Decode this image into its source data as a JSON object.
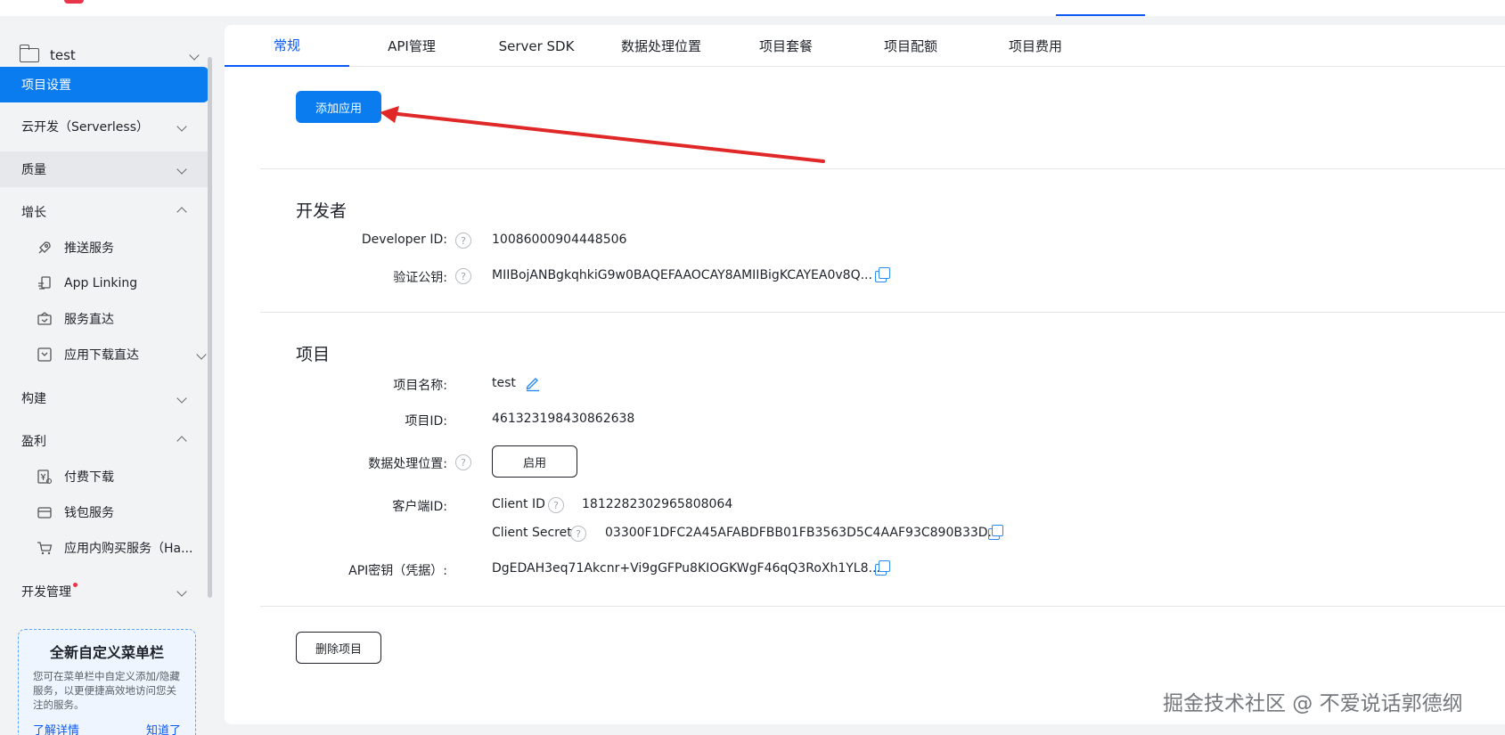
{
  "sidebar": {
    "project_name": "test",
    "nav": [
      {
        "label": "项目设置"
      },
      {
        "label": "云开发（Serverless）"
      },
      {
        "label": "质量"
      },
      {
        "label": "增长"
      },
      {
        "label": "构建"
      },
      {
        "label": "盈利"
      },
      {
        "label": "开发管理"
      }
    ],
    "growth_items": [
      {
        "label": "推送服务",
        "icon": "rocket-icon"
      },
      {
        "label": "App Linking",
        "icon": "link-icon"
      },
      {
        "label": "服务直达",
        "icon": "service-icon"
      },
      {
        "label": "应用下载直达",
        "icon": "download-icon"
      }
    ],
    "monetize_items": [
      {
        "label": "付费下载",
        "icon": "paid-download-icon"
      },
      {
        "label": "钱包服务",
        "icon": "wallet-icon"
      },
      {
        "label": "应用内购买服务（Ha...",
        "icon": "cart-icon"
      }
    ],
    "promo": {
      "title": "全新自定义菜单栏",
      "desc": "您可在菜单栏中自定义添加/隐藏服务，以更便捷高效地访问您关注的服务。",
      "learn_more": "了解详情",
      "got_it": "知道了"
    }
  },
  "tabs": [
    "常规",
    "API管理",
    "Server SDK",
    "数据处理位置",
    "项目套餐",
    "项目配额",
    "项目费用"
  ],
  "add_app_label": "添加应用",
  "developer": {
    "title": "开发者",
    "developer_id_label": "Developer ID:",
    "developer_id": "10086000904448506",
    "public_key_label": "验证公钥:",
    "public_key": "MIIBojANBgkqhkiG9w0BAQEFAAOCAY8AMIIBigKCAYEA0v8Q..."
  },
  "project": {
    "title": "项目",
    "name_label": "项目名称:",
    "name": "test",
    "id_label": "项目ID:",
    "id": "461323198430862638",
    "data_loc_label": "数据处理位置:",
    "enable_label": "启用",
    "client_label": "客户端ID:",
    "client_id_label": "Client ID",
    "client_id": "1812282302965808064",
    "client_secret_label": "Client Secret",
    "client_secret": "03300F1DFC2A45AFABDFBB01FB3563D5C4AAF93C890B33D...",
    "api_key_label": "API密钥（凭据）:",
    "api_key": "DgEDAH3eq71Akcnr+Vi9gGFPu8KIOGKWgF46qQ3RoXh1YL8...",
    "delete_label": "删除项目"
  },
  "help_glyph": "?",
  "watermark": "掘金技术社区 @ 不爱说话郭德纲"
}
